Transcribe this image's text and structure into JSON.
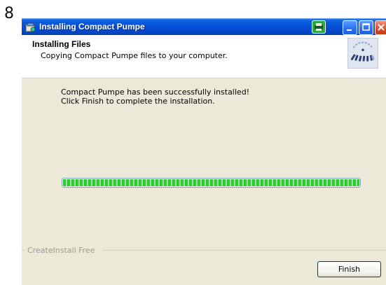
{
  "step_number": "8",
  "window": {
    "title": "Installing Compact Pumpe",
    "icon": "installer-icon",
    "tray_icon": "printer-icon",
    "controls": [
      "minimize-icon",
      "maximize-icon",
      "close-icon"
    ]
  },
  "header": {
    "title": "Installing Files",
    "subtitle": "Copying Compact Pumpe files to your computer.",
    "logo_icon": "setup-logo-icon"
  },
  "message": {
    "line1": "Compact Pumpe has been successfully installed!",
    "line2": "Click Finish to complete the installation."
  },
  "progress": {
    "value": 1.0
  },
  "footer": {
    "group_label": "CreateInstall Free",
    "finish_label": "Finish"
  },
  "colors": {
    "titlebar": "#0550d7",
    "progress": "#2ec12e",
    "window_bg": "#ece9d8"
  }
}
